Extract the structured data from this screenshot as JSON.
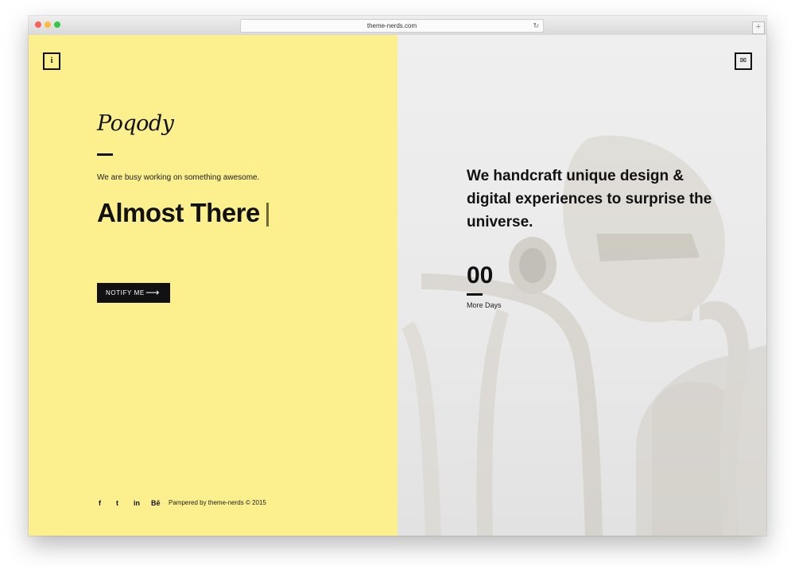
{
  "browser": {
    "url": "theme-nerds.com",
    "reload_icon": "reload-icon",
    "new_tab_label": "+"
  },
  "left_panel": {
    "background": "#fbef8e",
    "info_icon": "i",
    "logo": "Poqody",
    "tagline": "We are busy working on something awesome.",
    "headline": "Almost There",
    "notify_label": "NOTIFY ME",
    "notify_arrow": "⟶",
    "social": [
      "f",
      "t",
      "in",
      "Bē"
    ],
    "credit": "Pampered by theme-nerds © 2015"
  },
  "right_panel": {
    "mail_icon": "✉",
    "statement": "We handcraft unique design & digital experiences to surprise the universe.",
    "countdown_value": "00",
    "countdown_label": "More Days"
  }
}
